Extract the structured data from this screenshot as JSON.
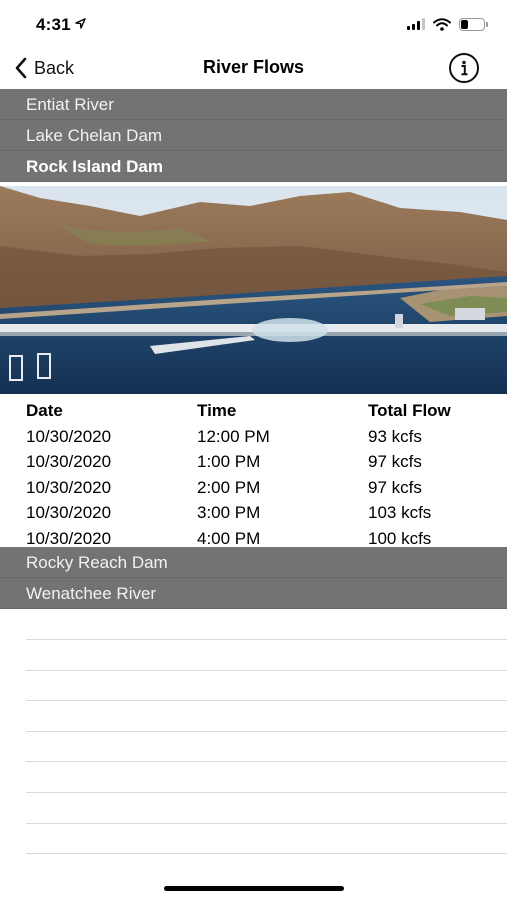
{
  "status_bar": {
    "time": "4:31",
    "location_icon": "location-arrow-icon",
    "signal_bars": 3,
    "battery_level": 0.35
  },
  "nav": {
    "back_label": "Back",
    "title": "River Flows",
    "info_icon": "info-circle-icon"
  },
  "rivers_top": [
    {
      "label": "Entiat River",
      "selected": false
    },
    {
      "label": "Lake Chelan Dam",
      "selected": false
    },
    {
      "label": "Rock Island Dam",
      "selected": true
    }
  ],
  "flow_table": {
    "headers": {
      "date": "Date",
      "time": "Time",
      "flow": "Total Flow"
    },
    "rows": [
      {
        "date": "10/30/2020",
        "time": "12:00 PM",
        "flow": "93 kcfs"
      },
      {
        "date": "10/30/2020",
        "time": "1:00 PM",
        "flow": "97 kcfs"
      },
      {
        "date": "10/30/2020",
        "time": "2:00 PM",
        "flow": "97 kcfs"
      },
      {
        "date": "10/30/2020",
        "time": "3:00 PM",
        "flow": "103 kcfs"
      },
      {
        "date": "10/30/2020",
        "time": "4:00 PM",
        "flow": "100 kcfs"
      }
    ]
  },
  "rivers_bottom": [
    {
      "label": "Rocky Reach Dam"
    },
    {
      "label": "Wenatchee River"
    }
  ],
  "colors": {
    "header_bg": "#737373",
    "header_text": "#f2f2f2",
    "water": "#1d3f66",
    "hills": "#8a6a4e"
  }
}
